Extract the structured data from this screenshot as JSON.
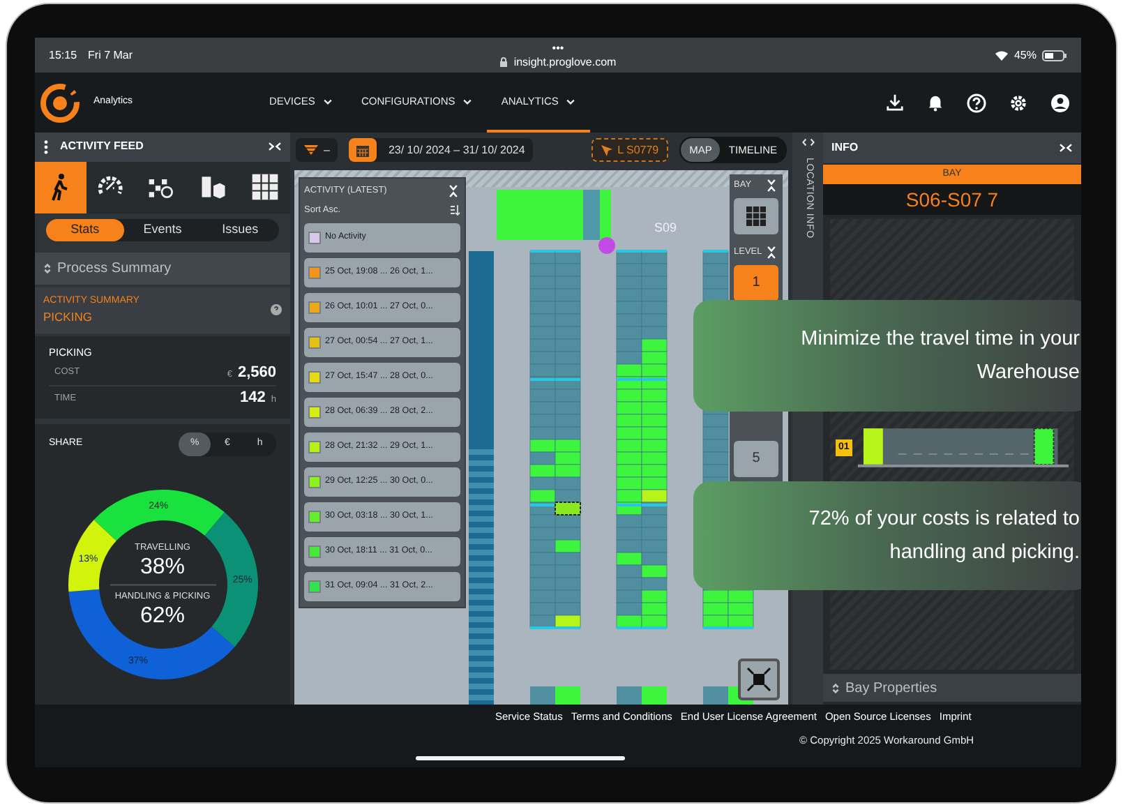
{
  "status_bar": {
    "time": "15:15",
    "date": "Fri 7 Mar",
    "dots": "•••",
    "url": "insight.proglove.com",
    "battery": "45%"
  },
  "navbar": {
    "app_name": "Analytics",
    "menu": [
      {
        "label": "DEVICES",
        "selected": false
      },
      {
        "label": "CONFIGURATIONS",
        "selected": false
      },
      {
        "label": "ANALYTICS",
        "selected": true
      }
    ]
  },
  "activity_feed": {
    "title": "ACTIVITY FEED",
    "category_tabs": [
      {
        "kind": "walker",
        "selected": true
      },
      {
        "kind": "gauge",
        "selected": false
      },
      {
        "kind": "mixed",
        "selected": false
      },
      {
        "kind": "boxes",
        "selected": false
      },
      {
        "kind": "grid",
        "selected": false
      }
    ],
    "view_tabs": [
      {
        "label": "Stats",
        "selected": true
      },
      {
        "label": "Events",
        "selected": false
      },
      {
        "label": "Issues",
        "selected": false
      }
    ],
    "process_summary": "Process Summary",
    "summary_title": "ACTIVITY SUMMARY",
    "summary_subtitle": "PICKING",
    "picking": {
      "title": "PICKING",
      "rows": [
        {
          "label": "COST",
          "prefix": "€",
          "value": "2,560"
        },
        {
          "label": "TIME",
          "value": "142",
          "suffix": "h"
        }
      ]
    },
    "share": {
      "label": "SHARE",
      "units": [
        {
          "label": "%",
          "selected": true
        },
        {
          "label": "€",
          "selected": false
        },
        {
          "label": "h",
          "selected": false
        }
      ],
      "chart_data": {
        "type": "donut",
        "values": [
          24,
          25,
          37,
          13
        ],
        "value_labels": [
          "24%",
          "25%",
          "37%",
          "13%"
        ]
      },
      "center": [
        {
          "label": "TRAVELLING",
          "value": "38%"
        },
        {
          "label": "HANDLING & PICKING",
          "value": "62%"
        }
      ]
    }
  },
  "map": {
    "filter": "–",
    "date_range": "23/ 10/ 2024 – 31/ 10/ 2024",
    "location": "L S0779",
    "view_toggle": [
      {
        "label": "MAP",
        "selected": true
      },
      {
        "label": "TIMELINE",
        "selected": false
      }
    ],
    "legend": {
      "title": "ACTIVITY (LATEST)",
      "sort": "Sort Asc.",
      "items": [
        {
          "label": "No Activity",
          "color": "#d8c9ec"
        },
        {
          "label": "25 Oct, 19:08 ... 26 Oct, 1...",
          "color": "#f39419"
        },
        {
          "label": "26 Oct, 10:01 ... 27 Oct, 0...",
          "color": "#eaa915"
        },
        {
          "label": "27 Oct, 00:54 ... 27 Oct, 1...",
          "color": "#e3c112"
        },
        {
          "label": "27 Oct, 15:47 ... 28 Oct, 0...",
          "color": "#e1dc10"
        },
        {
          "label": "28 Oct, 06:39 ... 28 Oct, 2...",
          "color": "#d3ee10"
        },
        {
          "label": "28 Oct, 21:32 ... 29 Oct, 1...",
          "color": "#b3f214"
        },
        {
          "label": "29 Oct, 12:25 ... 30 Oct, 0...",
          "color": "#8cf21c"
        },
        {
          "label": "30 Oct, 03:18 ... 30 Oct, 1...",
          "color": "#63ee2a"
        },
        {
          "label": "30 Oct, 18:11 ... 31 Oct, 0...",
          "color": "#48e83a"
        },
        {
          "label": "31 Oct, 09:04 ... 31 Oct, 2...",
          "color": "#33e24c"
        }
      ]
    },
    "zone_label": "S09",
    "bay_label": "BAY",
    "level_label": "LEVEL",
    "levels": [
      {
        "label": "1",
        "selected": true
      },
      {
        "label": "5",
        "selected": false
      }
    ]
  },
  "location_info": "LOCATION INFO",
  "info": {
    "title": "INFO",
    "section": "BAY",
    "bay_name": "S06-S07 7",
    "level_tag": "01",
    "properties": "Bay Properties"
  },
  "footer": {
    "links": [
      "Service Status",
      "Terms and Conditions",
      "End User License Agreement",
      "Open Source Licenses",
      "Imprint"
    ],
    "copyright": "© Copyright 2025 Workaround GmbH"
  },
  "callouts": [
    "Minimize the travel time in your Warehouse",
    "72% of your costs is related to handling and picking."
  ]
}
